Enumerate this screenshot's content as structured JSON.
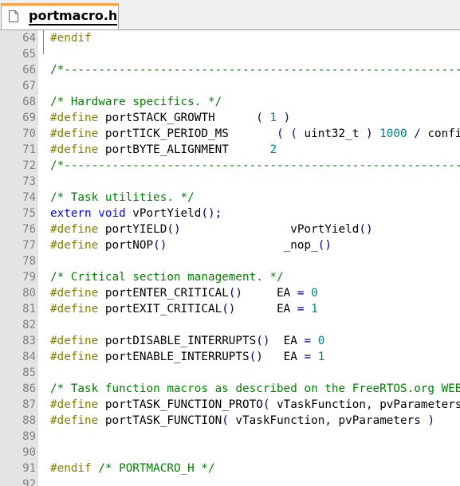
{
  "tab": {
    "filename": "portmacro.h",
    "icon": "file-icon",
    "accent_color": "#ff9f40"
  },
  "editor": {
    "colors": {
      "preprocessor": "#808000",
      "comment": "#008000",
      "keyword": "#0000ff",
      "number": "#008080",
      "operator": "#000080",
      "gutter_bg": "#e4e4e4",
      "line_number": "#808080"
    },
    "lines": [
      {
        "n": "64",
        "tokens": [
          [
            "pp",
            "#endif"
          ]
        ]
      },
      {
        "n": "65",
        "tokens": []
      },
      {
        "n": "66",
        "tokens": [
          [
            "cm",
            "/*-----------------------------------------------------------------------"
          ]
        ]
      },
      {
        "n": "67",
        "tokens": []
      },
      {
        "n": "68",
        "tokens": [
          [
            "cm",
            "/* Hardware specifics. */"
          ]
        ]
      },
      {
        "n": "69",
        "tokens": [
          [
            "pp",
            "#define "
          ],
          [
            "id",
            "portSTACK_GROWTH      "
          ],
          [
            "op",
            "( "
          ],
          [
            "nm",
            "1"
          ],
          [
            "op",
            " )"
          ]
        ]
      },
      {
        "n": "70",
        "tokens": [
          [
            "pp",
            "#define "
          ],
          [
            "id",
            "portTICK_PERIOD_MS       "
          ],
          [
            "op",
            "( ( "
          ],
          [
            "id",
            "uint32_t "
          ],
          [
            "op",
            ") "
          ],
          [
            "nm",
            "1000"
          ],
          [
            "op",
            " / "
          ],
          [
            "id",
            "configTICK_RATE_HZ )"
          ]
        ]
      },
      {
        "n": "71",
        "tokens": [
          [
            "pp",
            "#define "
          ],
          [
            "id",
            "portBYTE_ALIGNMENT      "
          ],
          [
            "nm",
            "2"
          ]
        ]
      },
      {
        "n": "72",
        "tokens": [
          [
            "cm",
            "/*-----------------------------------------------------------------------"
          ]
        ]
      },
      {
        "n": "73",
        "tokens": []
      },
      {
        "n": "74",
        "tokens": [
          [
            "cm",
            "/* Task utilities. */"
          ]
        ]
      },
      {
        "n": "75",
        "tokens": [
          [
            "kw",
            "extern void "
          ],
          [
            "id",
            "vPortYield"
          ],
          [
            "op",
            "();"
          ]
        ]
      },
      {
        "n": "76",
        "tokens": [
          [
            "pp",
            "#define "
          ],
          [
            "id",
            "portYIELD"
          ],
          [
            "op",
            "()"
          ],
          [
            "id",
            "                vPortYield"
          ],
          [
            "op",
            "()"
          ]
        ]
      },
      {
        "n": "77",
        "tokens": [
          [
            "pp",
            "#define "
          ],
          [
            "id",
            "portNOP"
          ],
          [
            "op",
            "()"
          ],
          [
            "id",
            "                 _nop_"
          ],
          [
            "op",
            "()"
          ]
        ]
      },
      {
        "n": "78",
        "tokens": []
      },
      {
        "n": "79",
        "tokens": [
          [
            "cm",
            "/* Critical section management. */"
          ]
        ]
      },
      {
        "n": "80",
        "tokens": [
          [
            "pp",
            "#define "
          ],
          [
            "id",
            "portENTER_CRITICAL"
          ],
          [
            "op",
            "()"
          ],
          [
            "id",
            "     EA "
          ],
          [
            "op",
            "= "
          ],
          [
            "nm",
            "0"
          ]
        ]
      },
      {
        "n": "81",
        "tokens": [
          [
            "pp",
            "#define "
          ],
          [
            "id",
            "portEXIT_CRITICAL"
          ],
          [
            "op",
            "()"
          ],
          [
            "id",
            "      EA "
          ],
          [
            "op",
            "= "
          ],
          [
            "nm",
            "1"
          ]
        ]
      },
      {
        "n": "82",
        "tokens": []
      },
      {
        "n": "83",
        "tokens": [
          [
            "pp",
            "#define "
          ],
          [
            "id",
            "portDISABLE_INTERRUPTS"
          ],
          [
            "op",
            "()"
          ],
          [
            "id",
            "  EA "
          ],
          [
            "op",
            "= "
          ],
          [
            "nm",
            "0"
          ]
        ]
      },
      {
        "n": "84",
        "tokens": [
          [
            "pp",
            "#define "
          ],
          [
            "id",
            "portENABLE_INTERRUPTS"
          ],
          [
            "op",
            "()"
          ],
          [
            "id",
            "   EA "
          ],
          [
            "op",
            "= "
          ],
          [
            "nm",
            "1"
          ]
        ]
      },
      {
        "n": "85",
        "tokens": []
      },
      {
        "n": "86",
        "tokens": [
          [
            "cm",
            "/* Task function macros as described on the FreeRTOS.org WEB site. */"
          ]
        ]
      },
      {
        "n": "87",
        "tokens": [
          [
            "pp",
            "#define "
          ],
          [
            "id",
            "portTASK_FUNCTION_PROTO"
          ],
          [
            "op",
            "( "
          ],
          [
            "id",
            "vTaskFunction"
          ],
          [
            "op",
            ", "
          ],
          [
            "id",
            "pvParameters "
          ],
          [
            "op",
            ")"
          ]
        ]
      },
      {
        "n": "88",
        "tokens": [
          [
            "pp",
            "#define "
          ],
          [
            "id",
            "portTASK_FUNCTION"
          ],
          [
            "op",
            "( "
          ],
          [
            "id",
            "vTaskFunction"
          ],
          [
            "op",
            ", "
          ],
          [
            "id",
            "pvParameters "
          ],
          [
            "op",
            ")"
          ]
        ]
      },
      {
        "n": "89",
        "tokens": []
      },
      {
        "n": "90",
        "tokens": []
      },
      {
        "n": "91",
        "tokens": [
          [
            "pp",
            "#endif "
          ],
          [
            "cm",
            "/* PORTMACRO_H */"
          ]
        ]
      },
      {
        "n": "92",
        "tokens": []
      }
    ]
  }
}
